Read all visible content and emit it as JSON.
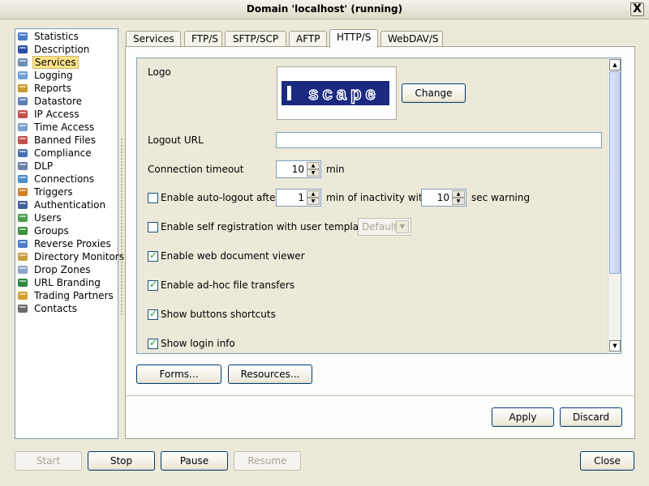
{
  "window": {
    "title": "Domain 'localhost' (running)",
    "close_glyph": "X"
  },
  "sidebar": {
    "items": [
      {
        "label": "Statistics",
        "icon": "statistics-icon"
      },
      {
        "label": "Description",
        "icon": "description-icon"
      },
      {
        "label": "Services",
        "icon": "services-icon",
        "selected": true
      },
      {
        "label": "Logging",
        "icon": "logging-icon"
      },
      {
        "label": "Reports",
        "icon": "reports-icon"
      },
      {
        "label": "Datastore",
        "icon": "datastore-icon"
      },
      {
        "label": "IP Access",
        "icon": "ip-access-icon"
      },
      {
        "label": "Time Access",
        "icon": "time-access-icon"
      },
      {
        "label": "Banned Files",
        "icon": "banned-files-icon"
      },
      {
        "label": "Compliance",
        "icon": "compliance-icon"
      },
      {
        "label": "DLP",
        "icon": "dlp-icon"
      },
      {
        "label": "Connections",
        "icon": "connections-icon"
      },
      {
        "label": "Triggers",
        "icon": "triggers-icon"
      },
      {
        "label": "Authentication",
        "icon": "authentication-icon"
      },
      {
        "label": "Users",
        "icon": "users-icon"
      },
      {
        "label": "Groups",
        "icon": "groups-icon"
      },
      {
        "label": "Reverse Proxies",
        "icon": "reverse-proxies-icon"
      },
      {
        "label": "Directory Monitors",
        "icon": "directory-monitors-icon"
      },
      {
        "label": "Drop Zones",
        "icon": "drop-zones-icon"
      },
      {
        "label": "URL Branding",
        "icon": "url-branding-icon"
      },
      {
        "label": "Trading Partners",
        "icon": "trading-partners-icon"
      },
      {
        "label": "Contacts",
        "icon": "contacts-icon"
      }
    ]
  },
  "tabs": [
    {
      "label": "Services"
    },
    {
      "label": "FTP/S"
    },
    {
      "label": "SFTP/SCP"
    },
    {
      "label": "AFTP"
    },
    {
      "label": "HTTP/S",
      "active": true
    },
    {
      "label": "WebDAV/S"
    }
  ],
  "http": {
    "logo_label": "Logo",
    "logo_text": "scape",
    "change_label": "Change",
    "logout_url_label": "Logout URL",
    "logout_url_value": "",
    "connection_timeout_label": "Connection timeout",
    "connection_timeout_value": "10",
    "connection_timeout_unit": "min",
    "auto_logout_label": "Enable auto-logout after",
    "auto_logout_checked": false,
    "auto_logout_value": "1",
    "auto_logout_mid": "min of inactivity with",
    "auto_logout_warning_value": "10",
    "auto_logout_warning_unit": "sec warning",
    "self_registration_label": "Enable self registration with user template",
    "self_registration_checked": false,
    "self_registration_template": "Default",
    "web_doc_viewer_label": "Enable web document viewer",
    "web_doc_viewer_checked": true,
    "adhoc_label": "Enable ad-hoc file transfers",
    "adhoc_checked": true,
    "buttons_shortcuts_label": "Show buttons shortcuts",
    "buttons_shortcuts_checked": true,
    "login_info_label": "Show login info",
    "login_info_checked": true
  },
  "panel_buttons": {
    "forms": "Forms...",
    "resources": "Resources..."
  },
  "action_buttons": {
    "apply": "Apply",
    "discard": "Discard"
  },
  "footer_buttons": {
    "start": "Start",
    "stop": "Stop",
    "pause": "Pause",
    "resume": "Resume",
    "close": "Close"
  },
  "colors": {
    "selection_bg": "#fbe28c",
    "logo_navy": "#1b2a80",
    "check_green": "#21a121"
  }
}
